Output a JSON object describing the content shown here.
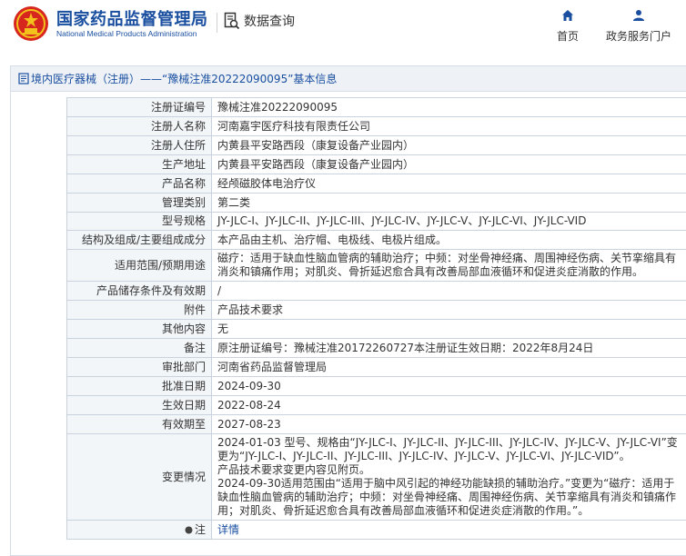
{
  "header": {
    "org_name_cn": "国家药品监督管理局",
    "org_name_en": "National Medical Products Administration",
    "query_label": "数据查询",
    "nav": {
      "home": "首页",
      "gov_portal": "政务服务门户"
    }
  },
  "panel": {
    "title": "境内医疗器械（注册）——“豫械注准20222090095”基本信息"
  },
  "rows": [
    {
      "key": "注册证编号",
      "value": "豫械注准20222090095"
    },
    {
      "key": "注册人名称",
      "value": "河南嘉宇医疗科技有限责任公司"
    },
    {
      "key": "注册人住所",
      "value": "内黄县平安路西段（康复设备产业园内）"
    },
    {
      "key": "生产地址",
      "value": "内黄县平安路西段（康复设备产业园内）"
    },
    {
      "key": "产品名称",
      "value": "经颅磁胶体电治疗仪"
    },
    {
      "key": "管理类别",
      "value": "第二类"
    },
    {
      "key": "型号规格",
      "value": "JY-JLC-I、JY-JLC-II、JY-JLC-III、JY-JLC-IV、JY-JLC-V、JY-JLC-VI、JY-JLC-VID"
    },
    {
      "key": "结构及组成/主要组成成分",
      "value": "本产品由主机、治疗帽、电极线、电极片组成。"
    },
    {
      "key": "适用范围/预期用途",
      "value": "磁疗：适用于缺血性脑血管病的辅助治疗；中频：对坐骨神经痛、周围神经伤病、关节挛缩具有消炎和镇痛作用；对肌炎、骨折延迟愈合具有改善局部血液循环和促进炎症消散的作用。"
    },
    {
      "key": "产品储存条件及有效期",
      "value": "/"
    },
    {
      "key": "附件",
      "value": "产品技术要求"
    },
    {
      "key": "其他内容",
      "value": "无"
    },
    {
      "key": "备注",
      "value": "原注册证编号：豫械注准20172260727本注册证生效日期：2022年8月24日"
    },
    {
      "key": "审批部门",
      "value": "河南省药品监督管理局"
    },
    {
      "key": "批准日期",
      "value": "2024-09-30"
    },
    {
      "key": "生效日期",
      "value": "2022-08-24"
    },
    {
      "key": "有效期至",
      "value": "2027-08-23"
    }
  ],
  "change": {
    "key": "变更情况",
    "line1": "2024-01-03 型号、规格由“JY-JLC-I、JY-JLC-II、JY-JLC-III、JY-JLC-IV、JY-JLC-V、JY-JLC-VI”变更为“JY-JLC-I、JY-JLC-II、JY-JLC-III、JY-JLC-IV、JY-JLC-V、JY-JLC-VI、JY-JLC-VID”。",
    "line2": "产品技术要求变更内容见附页。",
    "line3": "2024-09-30适用范围由“适用于脑中风引起的神经功能缺损的辅助治疗。”变更为“磁疗：适用于缺血性脑血管病的辅助治疗；中频：对坐骨神经痛、周围神经伤病、关节挛缩具有消炎和镇痛作用；对肌炎、骨折延迟愈合具有改善局部血液循环和促进炎症消散的作用。”。"
  },
  "note": {
    "key": "注",
    "link_text": "详情"
  },
  "colors": {
    "brand_blue": "#1a4fa0",
    "emblem_red": "#d7261e",
    "emblem_gold": "#f3c11b"
  }
}
